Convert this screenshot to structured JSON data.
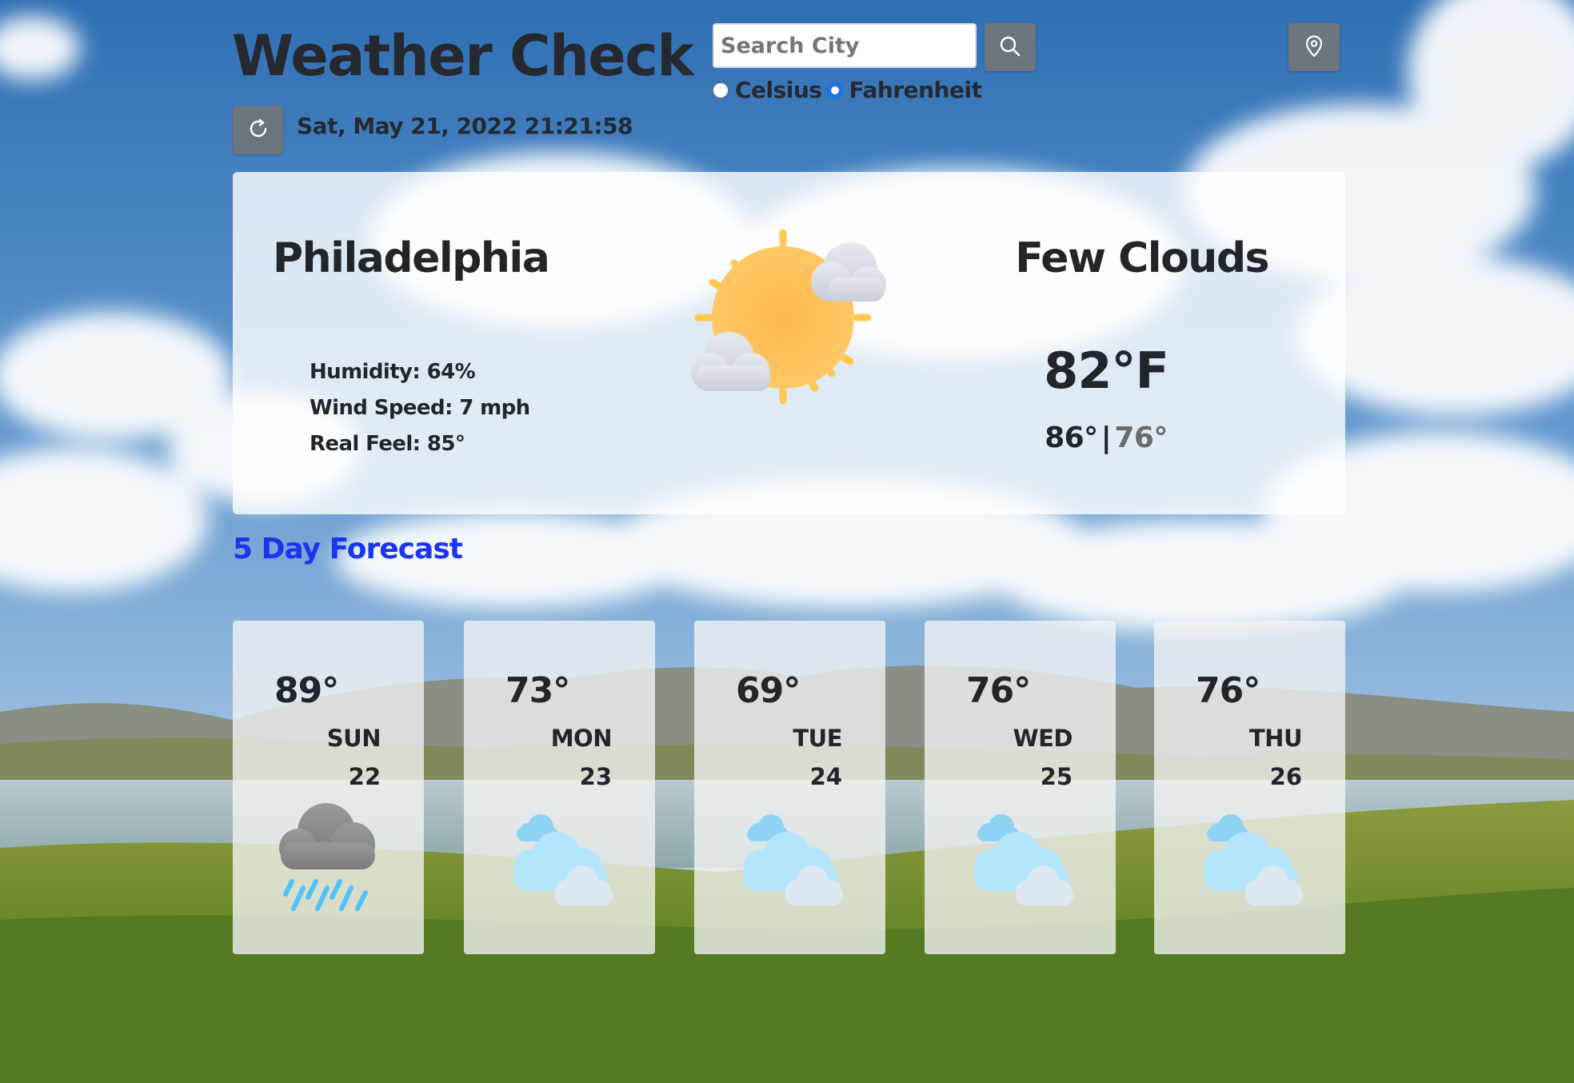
{
  "app": {
    "title": "Weather Check",
    "datetime": "Sat, May 21, 2022 21:21:58"
  },
  "search": {
    "placeholder": "Search City",
    "value": ""
  },
  "units": {
    "options": [
      "Celsius",
      "Fahrenheit"
    ],
    "selected": "Fahrenheit"
  },
  "current": {
    "city": "Philadelphia",
    "condition": "Few Clouds",
    "temperature": "82°F",
    "high": "86°",
    "separator": "|",
    "low": "76°",
    "humidity": "Humidity: 64%",
    "wind": "Wind Speed: 7 mph",
    "real_feel": "Real Feel: 85°",
    "icon": "sun-with-few-clouds-icon"
  },
  "forecast": {
    "title": "5 Day Forecast",
    "days": [
      {
        "temp": "89°",
        "day": "SUN",
        "date": "22",
        "icon": "rain-cloud-icon"
      },
      {
        "temp": "73°",
        "day": "MON",
        "date": "23",
        "icon": "clouds-icon"
      },
      {
        "temp": "69°",
        "day": "TUE",
        "date": "24",
        "icon": "clouds-icon"
      },
      {
        "temp": "76°",
        "day": "WED",
        "date": "25",
        "icon": "clouds-icon"
      },
      {
        "temp": "76°",
        "day": "THU",
        "date": "26",
        "icon": "clouds-icon"
      }
    ]
  },
  "colors": {
    "button_bg": "#6c757d",
    "forecast_title": "#1a35f0",
    "radio_checked": "#1a73e8",
    "low_temp": "#6b6b6b"
  }
}
